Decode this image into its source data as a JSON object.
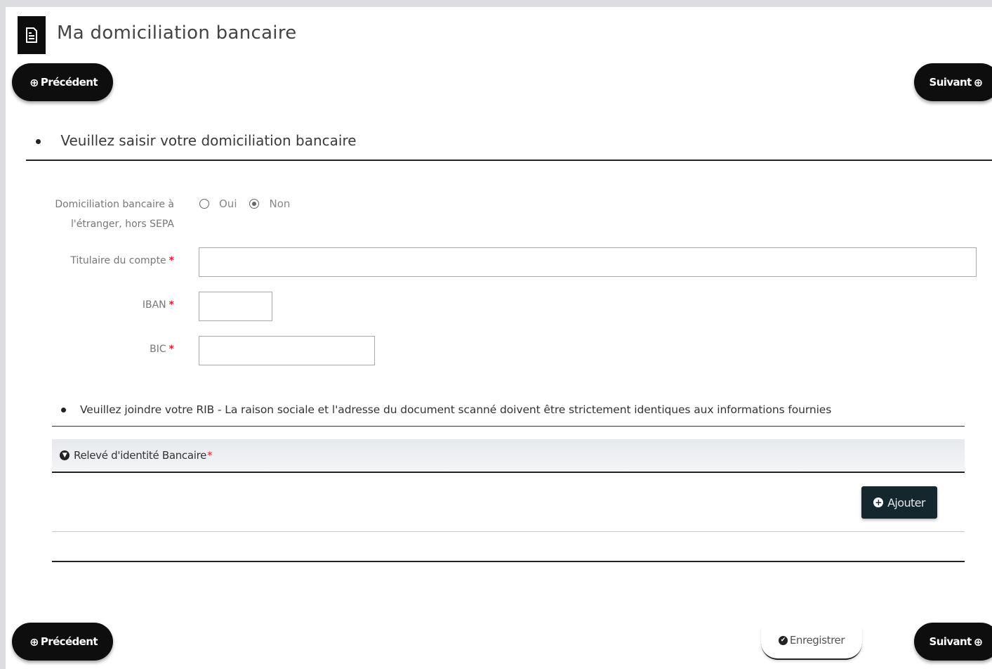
{
  "header": {
    "title": "Ma domiciliation bancaire",
    "icon": "document-icon"
  },
  "nav": {
    "previous_label": "Précédent",
    "next_label": "Suivant",
    "previous_icon": "⊕",
    "next_icon": "⊕"
  },
  "section": {
    "title": "Veuillez saisir votre domiciliation bancaire"
  },
  "form": {
    "foreign_label_line1": "Domiciliation bancaire à",
    "foreign_label_line2": "l'étranger, hors SEPA",
    "radio_yes": "Oui",
    "radio_no": "Non",
    "selected": "Non",
    "holder_label": "Titulaire du compte",
    "holder_value": "",
    "iban_label": "IBAN",
    "iban_value": "",
    "bic_label": "BIC",
    "bic_value": "",
    "required_marker": "*"
  },
  "attachment": {
    "instruction": "Veuillez joindre votre RIB - La raison sociale et l'adresse du document scanné doivent être strictement identiques aux informations fournies",
    "accordion_title": "Relevé d'identité Bancaire",
    "required_marker": "*",
    "add_label": "Ajouter"
  },
  "footer": {
    "save_label": "Enregistrer"
  },
  "colors": {
    "pill_bg": "#0e0e0e",
    "add_button_bg": "#14262e",
    "required": "#e02020"
  }
}
